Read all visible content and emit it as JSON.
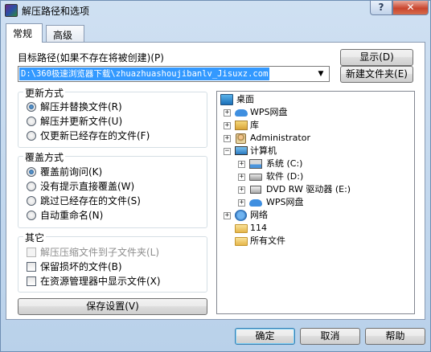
{
  "window": {
    "title": "解压路径和选项",
    "help_glyph": "?",
    "close_glyph": "✕"
  },
  "tabs": [
    {
      "label": "常规",
      "active": true
    },
    {
      "label": "高级",
      "active": false
    }
  ],
  "destination": {
    "label": "目标路径(如果不存在将被创建)(P)",
    "value": "D:\\360极速浏览器下载\\zhuazhuashoujibanlv_Jisuxz.com",
    "dropdown_glyph": "▼"
  },
  "buttons": {
    "show": "显示(D)",
    "new_folder": "新建文件夹(E)",
    "save_settings": "保存设置(V)",
    "ok": "确定",
    "cancel": "取消",
    "help": "帮助"
  },
  "update_mode": {
    "title": "更新方式",
    "options": [
      {
        "label": "解压并替换文件(R)",
        "selected": true
      },
      {
        "label": "解压并更新文件(U)",
        "selected": false
      },
      {
        "label": "仅更新已经存在的文件(F)",
        "selected": false
      }
    ]
  },
  "overwrite_mode": {
    "title": "覆盖方式",
    "options": [
      {
        "label": "覆盖前询问(K)",
        "selected": true
      },
      {
        "label": "没有提示直接覆盖(W)",
        "selected": false
      },
      {
        "label": "跳过已经存在的文件(S)",
        "selected": false
      },
      {
        "label": "自动重命名(N)",
        "selected": false
      }
    ]
  },
  "misc": {
    "title": "其它",
    "options": [
      {
        "label": "解压压缩文件到子文件夹(L)",
        "checked": false,
        "enabled": false
      },
      {
        "label": "保留损坏的文件(B)",
        "checked": false,
        "enabled": true
      },
      {
        "label": "在资源管理器中显示文件(X)",
        "checked": false,
        "enabled": true
      }
    ]
  },
  "tree": {
    "nodes": [
      {
        "label": "桌面",
        "icon": "desktop-icon",
        "expander": ""
      },
      {
        "label": "WPS网盘",
        "icon": "cloud-icon",
        "expander": "+"
      },
      {
        "label": "库",
        "icon": "library-icon",
        "expander": "+"
      },
      {
        "label": "Administrator",
        "icon": "user-folder-icon",
        "expander": "+"
      },
      {
        "label": "计算机",
        "icon": "computer-icon",
        "expander": "−"
      },
      {
        "label": "系统 (C:)",
        "icon": "system-drive-icon",
        "expander": "+"
      },
      {
        "label": "软件 (D:)",
        "icon": "drive-icon",
        "expander": "+"
      },
      {
        "label": "DVD RW 驱动器 (E:)",
        "icon": "dvd-drive-icon",
        "expander": "+"
      },
      {
        "label": "WPS网盘",
        "icon": "cloud-icon",
        "expander": "+"
      },
      {
        "label": "网络",
        "icon": "network-icon",
        "expander": "+"
      },
      {
        "label": "114",
        "icon": "folder-icon",
        "expander": ""
      },
      {
        "label": "所有文件",
        "icon": "folder-icon",
        "expander": ""
      }
    ]
  }
}
